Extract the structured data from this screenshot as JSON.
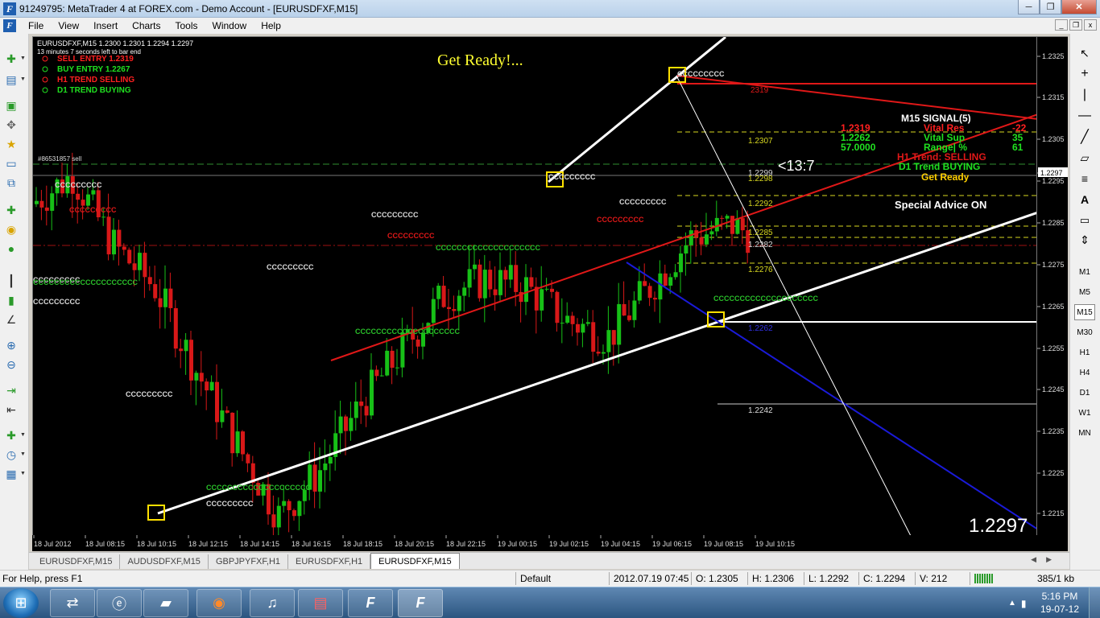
{
  "window": {
    "title": "91249795: MetaTrader 4 at FOREX.com - Demo Account - [EURUSDFXF,M15]",
    "app_icon": "F",
    "controls": {
      "minimize": "─",
      "maximize": "❐",
      "close": "✕"
    }
  },
  "menu": {
    "items": [
      "File",
      "View",
      "Insert",
      "Charts",
      "Tools",
      "Window",
      "Help"
    ],
    "mdi_controls": {
      "minimize": "_",
      "restore": "❐",
      "close": "x"
    }
  },
  "chart": {
    "header": "EURUSDFXF,M15  1.2300 1.2301 1.2294 1.2297",
    "countdown": "13 minutes 7 seconds left to bar end",
    "legend": [
      {
        "text": "SELL ENTRY  1.2319",
        "color": "#ff2020"
      },
      {
        "text": "BUY ENTRY  1.2267",
        "color": "#20e020"
      },
      {
        "text": "H1 TREND SELLING",
        "color": "#ff2020"
      },
      {
        "text": "D1 TREND BUYING",
        "color": "#20e020"
      }
    ],
    "banner": "Get Ready!...",
    "order_label": "#86531857 sell",
    "countdown_big": "<13:7",
    "big_price": "1.2297",
    "level_labels": [
      "2319",
      "1.2307",
      "1.2299",
      "1.2298",
      "1.2292",
      "1.2285",
      "1.2282",
      "1.2276",
      "1.2262",
      "1.2242"
    ],
    "signal_panel": {
      "title": "M15 SIGNAL(5)",
      "rows": [
        {
          "value": "1.2319",
          "label": "Vital Res",
          "num": "-22",
          "color": "#ff2020"
        },
        {
          "value": "1.2262",
          "label": "Vital Sup",
          "num": "35",
          "color": "#20e020"
        },
        {
          "value": "57.0000",
          "label": "Range| %",
          "num": "61",
          "color": "#20e020"
        }
      ],
      "h1_trend": "H1 Trend: SELLING",
      "d1_trend": "D1 Trend BUYING",
      "get_ready": "Get Ready",
      "special": "Special Advice ON"
    },
    "price_axis": [
      "1.2325",
      "1.2315",
      "1.2305",
      "1.2297",
      "1.2295",
      "1.2285",
      "1.2275",
      "1.2265",
      "1.2255",
      "1.2245",
      "1.2235",
      "1.2225",
      "1.2215"
    ],
    "current_price_tag": "1.2297",
    "time_axis": [
      "18 Jul 2012",
      "18 Jul 08:15",
      "18 Jul 10:15",
      "18 Jul 12:15",
      "18 Jul 14:15",
      "18 Jul 16:15",
      "18 Jul 18:15",
      "18 Jul 20:15",
      "18 Jul 22:15",
      "19 Jul 00:15",
      "19 Jul 02:15",
      "19 Jul 04:15",
      "19 Jul 06:15",
      "19 Jul 08:15",
      "19 Jul 10:15"
    ]
  },
  "timeframes": [
    "M1",
    "M5",
    "M15",
    "M30",
    "H1",
    "H4",
    "D1",
    "W1",
    "MN"
  ],
  "selected_timeframe": "M15",
  "tabs": [
    "EURUSDFXF,M15",
    "AUDUSDFXF,M15",
    "GBPJPYFXF,H1",
    "EURUSDFXF,H1",
    "EURUSDFXF,M15"
  ],
  "active_tab_index": 4,
  "status": {
    "help": "For Help, press F1",
    "profile": "Default",
    "datetime": "2012.07.19 07:45",
    "open": "O: 1.2305",
    "high": "H: 1.2306",
    "low": "L: 1.2292",
    "close": "C: 1.2294",
    "volume": "V: 212",
    "traffic": "385/1 kb"
  },
  "taskbar": {
    "time": "5:16 PM",
    "date": "19-07-12"
  }
}
